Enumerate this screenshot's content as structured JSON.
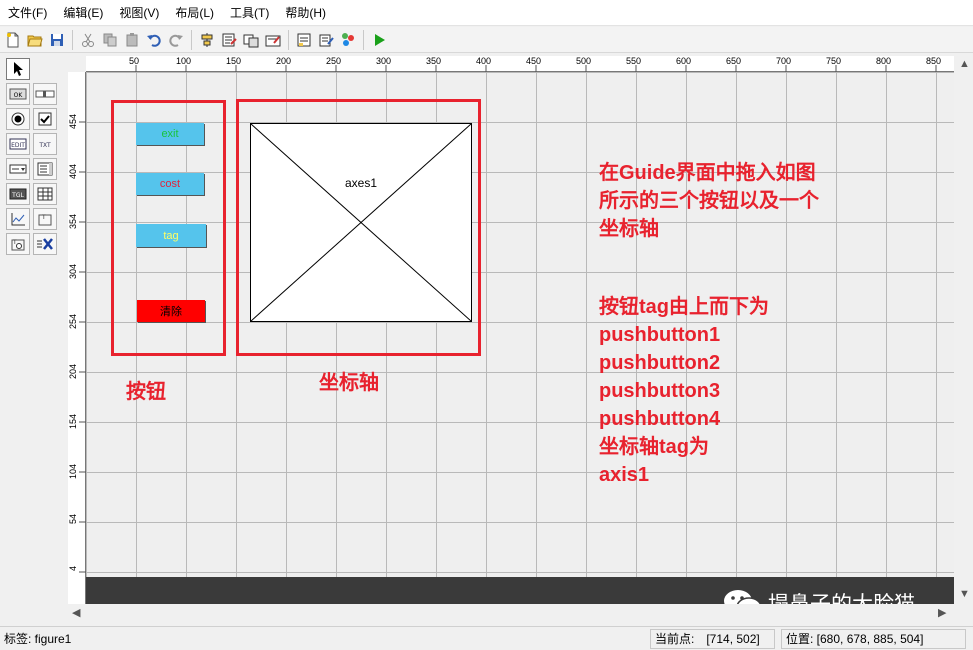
{
  "menu": [
    "文件(F)",
    "编辑(E)",
    "视图(V)",
    "布局(L)",
    "工具(T)",
    "帮助(H)"
  ],
  "rulers": {
    "top_ticks": [
      "50",
      "100",
      "150",
      "200",
      "250",
      "300",
      "350",
      "400",
      "450",
      "500",
      "550",
      "600",
      "650",
      "700",
      "750",
      "800",
      "850"
    ],
    "left_ticks": [
      "454",
      "404",
      "354",
      "304",
      "254",
      "204",
      "154",
      "104",
      "54",
      "4"
    ]
  },
  "figure": {
    "buttons": [
      {
        "label": "exit",
        "color": "#55c4ec",
        "text_color": "#18c43a"
      },
      {
        "label": "cost",
        "color": "#55c4ec",
        "text_color": "#e0243c"
      },
      {
        "label": "tag",
        "color": "#55c4ec",
        "text_color": "#ffff66"
      },
      {
        "label": "清除",
        "color": "#ff0000",
        "text_color": "#000000"
      }
    ],
    "axes_label": "axes1"
  },
  "annotations": {
    "buttons_label": "按钮",
    "axes_label": "坐标轴",
    "desc_lines": [
      "在Guide界面中拖入如图",
      "所示的三个按钮以及一个",
      "坐标轴"
    ],
    "tag_lines": [
      "按钮tag由上而下为",
      "pushbutton1",
      "pushbutton2",
      "pushbutton3",
      "pushbutton4",
      "坐标轴tag为",
      "axis1"
    ],
    "color": "#e8222e"
  },
  "status": {
    "tag": "标签: figure1",
    "current_point_label": "当前点:",
    "current_point_value": "[714, 502]",
    "position": "位置: [680, 678, 885, 504]"
  },
  "watermark": "塌鼻子的大脸猫"
}
